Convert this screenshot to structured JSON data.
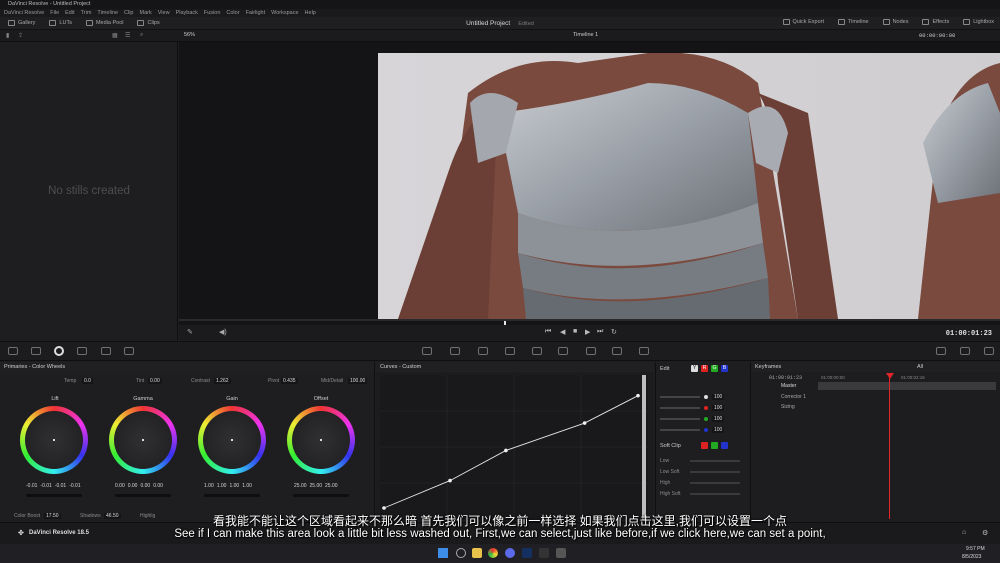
{
  "app": {
    "title": "DaVinci Resolve - Untitled Project",
    "project_title": "Untitled Project",
    "edit_state": "Edited"
  },
  "menu": [
    "DaVinci Resolve",
    "File",
    "Edit",
    "Trim",
    "Timeline",
    "Clip",
    "Mark",
    "View",
    "Playback",
    "Fusion",
    "Color",
    "Fairlight",
    "Workspace",
    "Help"
  ],
  "topbar": {
    "left": [
      "Gallery",
      "LUTs",
      "Media Pool",
      "Clips"
    ],
    "right": [
      "Quick Export",
      "Timeline",
      "Nodes",
      "Effects",
      "Lightbox"
    ]
  },
  "viewer": {
    "zoom": "56%",
    "timeline_name": "Timeline 1",
    "timecode_top": "00:00:00:00",
    "timecode": "01:00:01:23"
  },
  "gallery": {
    "empty_text": "No stills created"
  },
  "primaries": {
    "title": "Primaries - Color Wheels",
    "temp_label": "Temp",
    "temp": "0.0",
    "tint_label": "Tint",
    "tint": "0.00",
    "contrast_label": "Contrast",
    "contrast": "1.262",
    "pivot_label": "Pivot",
    "pivot": "0.435",
    "middetail_label": "Mid/Detail",
    "middetail": "100.00",
    "wheels": [
      {
        "label": "Lift",
        "values": [
          "-0.01",
          "-0.01",
          "-0.01",
          "-0.01"
        ]
      },
      {
        "label": "Gamma",
        "values": [
          "0.00",
          "0.00",
          "0.00",
          "0.00"
        ]
      },
      {
        "label": "Gain",
        "values": [
          "1.00",
          "1.00",
          "1.00",
          "1.00"
        ]
      },
      {
        "label": "Offset",
        "values": [
          "25.00",
          "25.00",
          "25.00"
        ]
      }
    ],
    "colorboost_label": "Color Boost",
    "colorboost": "17.50",
    "shadows_label": "Shadows",
    "shadows": "46.50",
    "highlights_label": "Highlig"
  },
  "curves": {
    "title": "Curves - Custom",
    "points": [
      [
        0.0,
        0.0
      ],
      [
        0.26,
        0.2
      ],
      [
        0.48,
        0.42
      ],
      [
        0.79,
        0.62
      ],
      [
        1.0,
        0.82
      ]
    ]
  },
  "edit": {
    "title": "Edit",
    "channels": [
      "Y",
      "R",
      "G",
      "B"
    ],
    "values": [
      "100",
      "100",
      "100",
      "100"
    ],
    "softclip_title": "Soft Clip",
    "softclip_items": [
      "Low",
      "Low Soft",
      "High",
      "High Soft"
    ]
  },
  "keyframes": {
    "title": "Keyframes",
    "filter": "All",
    "timecode": "01:00:01:23",
    "ruler": [
      "01:00:00:00",
      "01:00:02:16"
    ],
    "tracks": [
      "Master",
      "Corrector 1",
      "Sizing"
    ]
  },
  "brand": {
    "name": "DaVinci Resolve 18.5"
  },
  "subtitles": {
    "zh": "看我能不能让这个区域看起来不那么暗 首先我们可以像之前一样选择 如果我们点击这里,我们可以设置一个点",
    "en": "See if I can make this area look a little bit less washed out, First,we can select,just like before,if we click here,we can set a point,"
  },
  "taskbar": {
    "time": "9:57 PM",
    "date": "8/5/2023"
  },
  "colors": {
    "accent_red": "#e0262a",
    "bg": "#1e1e20"
  }
}
